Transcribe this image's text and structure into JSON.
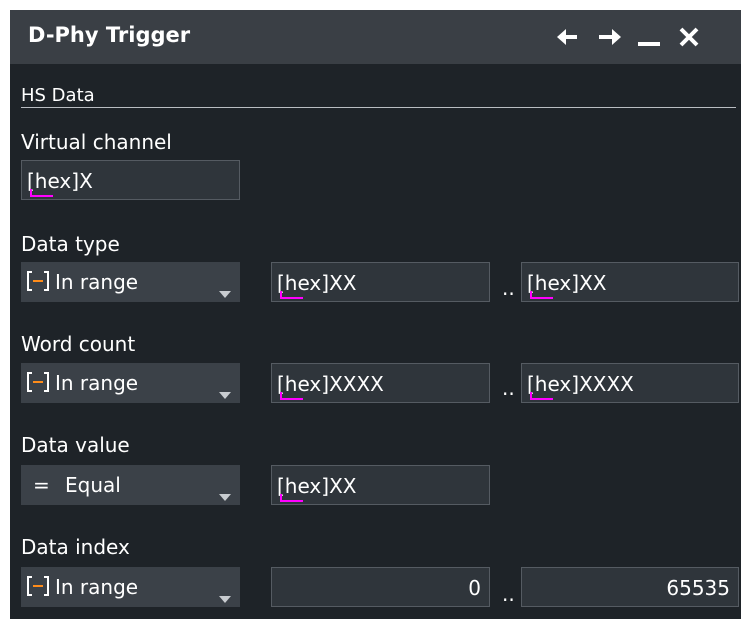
{
  "dialog": {
    "title": "D-Phy Trigger",
    "buttons": {
      "back": "arrow-left-icon",
      "forward": "arrow-right-icon",
      "minimize": "minimize-icon",
      "close": "close-icon"
    }
  },
  "section": {
    "header": "HS Data"
  },
  "virtual_channel": {
    "label": "Virtual channel",
    "value": "[hex]X"
  },
  "data_type": {
    "label": "Data type",
    "condition": {
      "icon": "[−]",
      "text": "In range"
    },
    "from": "[hex]XX",
    "separator": "..",
    "to": "[hex]XX"
  },
  "word_count": {
    "label": "Word count",
    "condition": {
      "icon": "[−]",
      "text": "In range"
    },
    "from": "[hex]XXXX",
    "separator": "..",
    "to": "[hex]XXXX"
  },
  "data_value": {
    "label": "Data value",
    "condition": {
      "icon": "=",
      "text": "Equal"
    },
    "value": "[hex]XX"
  },
  "data_index": {
    "label": "Data index",
    "condition": {
      "icon": "[−]",
      "text": "In range"
    },
    "from": "0",
    "separator": "..",
    "to": "65535"
  },
  "colors": {
    "background": "#1e2328",
    "titlebar": "#3a3f45",
    "field": "#2f353b",
    "select": "#3b4148",
    "hex_marker": "#ff00ff",
    "range_icon_accent": "#ff8c1a"
  }
}
